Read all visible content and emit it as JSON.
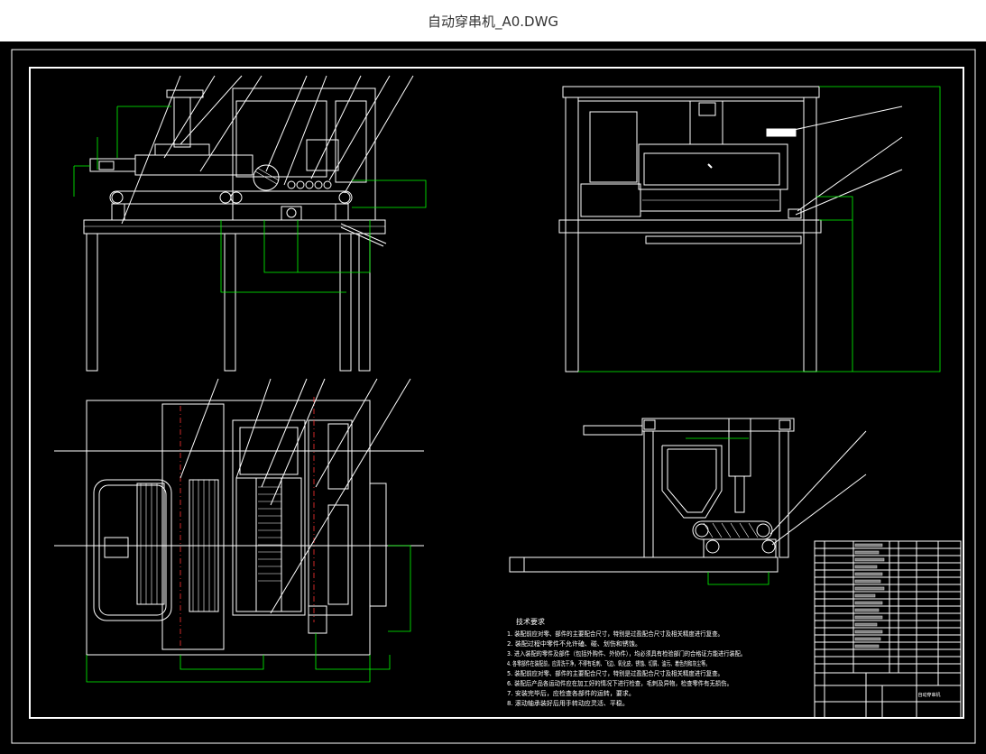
{
  "window": {
    "title": "自动穿串机_A0.DWG"
  },
  "drawing": {
    "notes_title": "技术要求",
    "notes": [
      "1. 装配前应对零、部件的主要配合尺寸，特别是过盈配合尺寸及相关精度进行复查。",
      "2. 装配过程中零件不允许磕、碰、划伤和锈蚀。",
      "3. 进入装配的零件及部件（包括外购件、外协件），均必须具有检验部门的合格证方能进行装配。",
      "4. 各零部件在装配前，应清洗干净，不得有毛刺、飞边、氧化皮、锈蚀、切屑、油污、着色剂和灰尘等。",
      "5. 装配前应对零、部件的主要配合尺寸，特别是过盈配合尺寸及相关精度进行复查。",
      "6. 装配后产品各运动件应在加工好的情况下进行检查，毛刺及异物，检查零件有无损伤。",
      "7. 安装完毕后，应检查各部件的运转，要求。",
      "8. 滚动轴承装好后用手转动应灵活、平稳。"
    ],
    "title_block": {
      "drawing_name": "自动穿串机"
    }
  }
}
